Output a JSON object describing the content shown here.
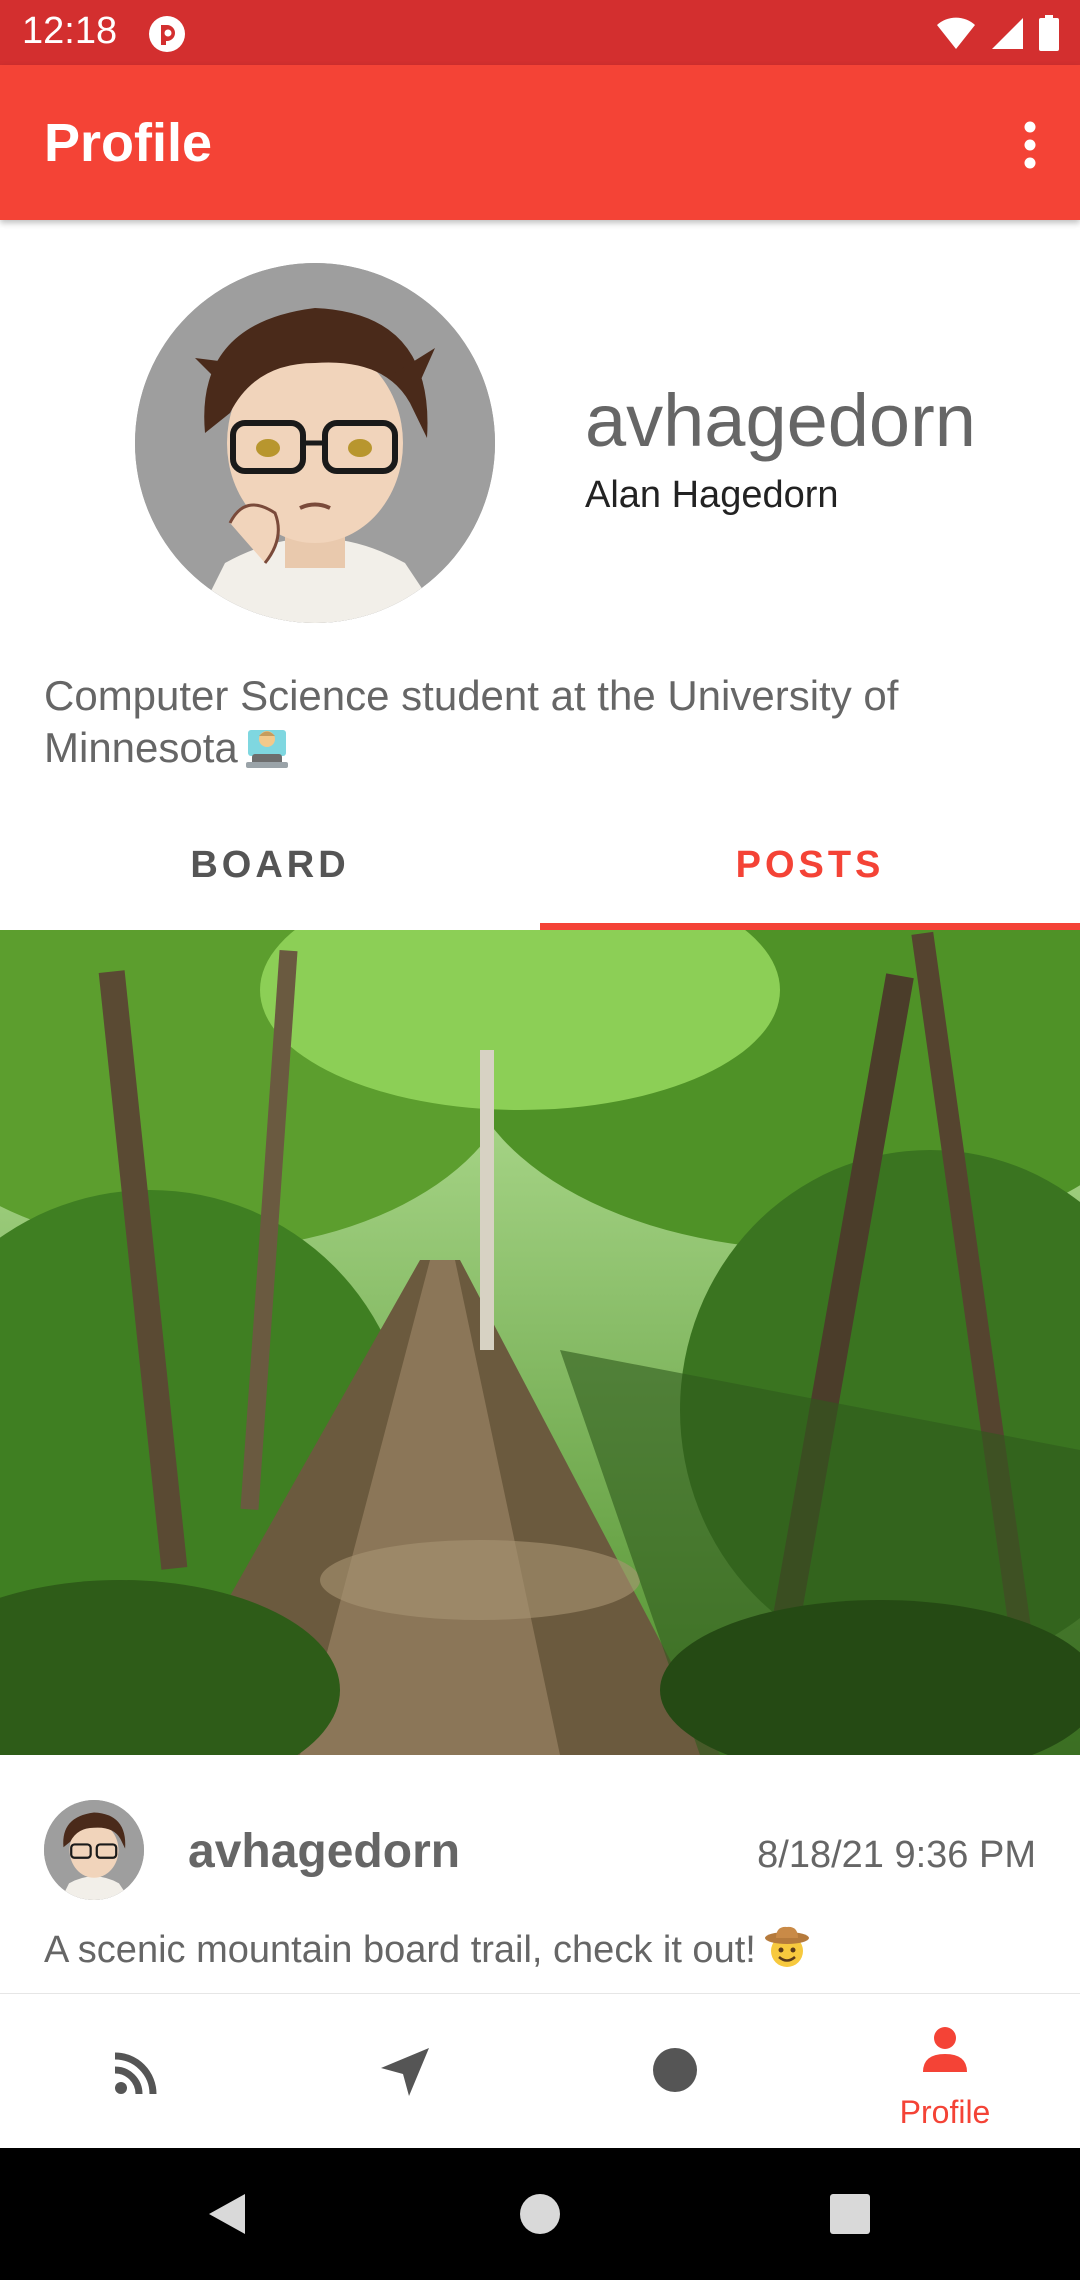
{
  "status_bar": {
    "time": "12:18"
  },
  "app_bar": {
    "title": "Profile"
  },
  "profile": {
    "username": "avhagedorn",
    "full_name": "Alan Hagedorn",
    "bio": "Computer Science student at the University of Minnesota"
  },
  "tabs": [
    {
      "label": "BOARD",
      "selected": false
    },
    {
      "label": "POSTS",
      "selected": true
    }
  ],
  "post": {
    "username": "avhagedorn",
    "timestamp": "8/18/21 9:36 PM",
    "caption": "A scenic mountain board trail, check it out!"
  },
  "bottom_nav": {
    "items": [
      {
        "icon": "rss-feed-icon",
        "label": ""
      },
      {
        "icon": "navigation-arrow-icon",
        "label": ""
      },
      {
        "icon": "record-circle-icon",
        "label": ""
      },
      {
        "icon": "person-icon",
        "label": "Profile"
      }
    ],
    "active_color": "#f44336"
  },
  "colors": {
    "accent": "#f44336",
    "status_bar": "#d32f2f"
  }
}
